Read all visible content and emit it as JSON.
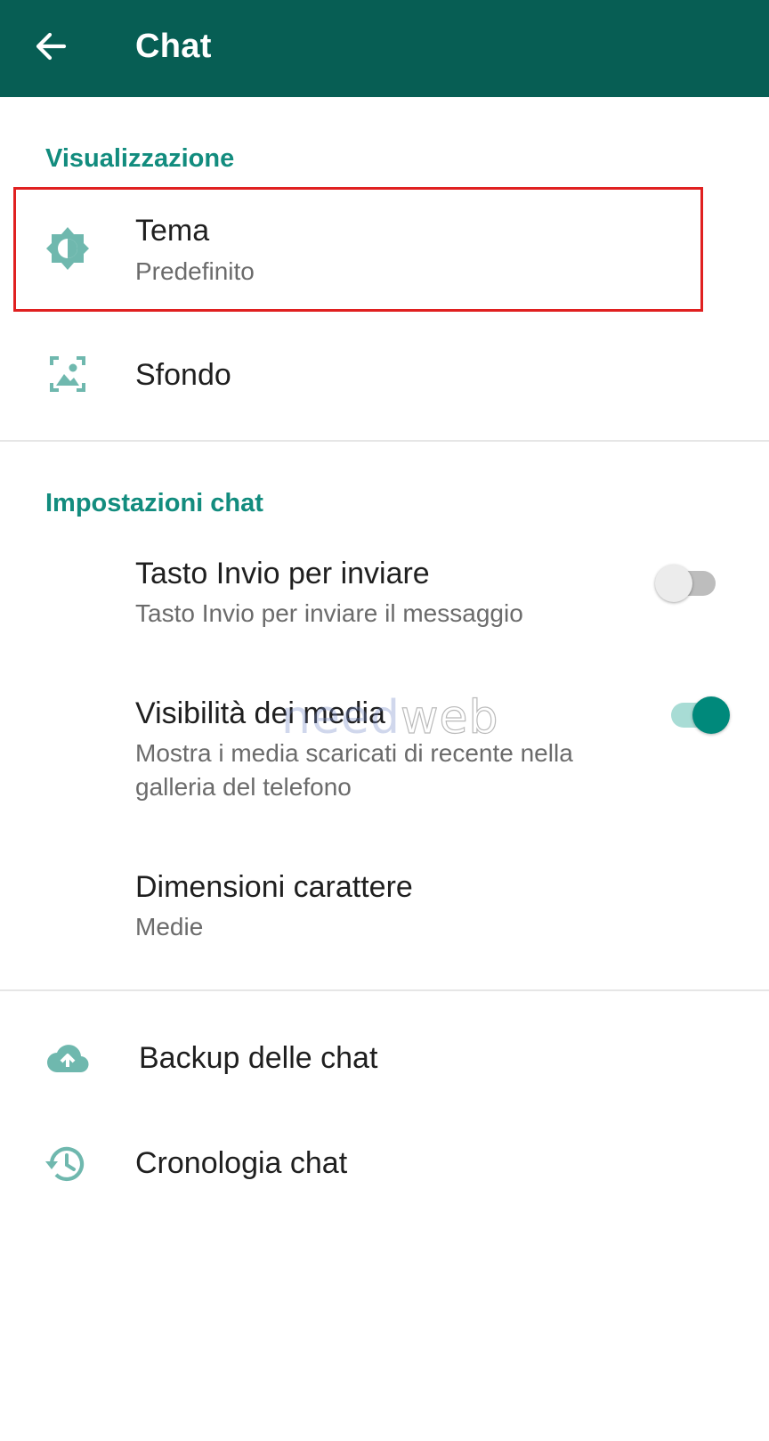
{
  "appbar": {
    "title": "Chat",
    "back_icon": "arrow-left-icon",
    "background_color": "#075e54"
  },
  "sections": {
    "display_header": "Visualizzazione",
    "chat_settings_header": "Impostazioni chat"
  },
  "rows": {
    "theme": {
      "title": "Tema",
      "subtitle": "Predefinito",
      "icon": "brightness-icon"
    },
    "wallpaper": {
      "title": "Sfondo",
      "icon": "wallpaper-icon"
    },
    "enter_send": {
      "title": "Tasto Invio per inviare",
      "subtitle": "Tasto Invio per inviare il messaggio",
      "toggle": false
    },
    "media_visibility": {
      "title": "Visibilità dei media",
      "subtitle_line1": "Mostra i media scaricati di recente nella",
      "subtitle_line2": "galleria del telefono",
      "toggle": true
    },
    "font_size": {
      "title": "Dimensioni carattere",
      "subtitle": "Medie"
    },
    "backup": {
      "title": "Backup delle chat",
      "icon": "cloud-upload-icon"
    },
    "history": {
      "title": "Cronologia chat",
      "icon": "history-icon"
    }
  },
  "watermark": {
    "part1": "need",
    "part2": "web"
  },
  "colors": {
    "accent": "#128c7e",
    "icon_tint": "#6fb8ae",
    "toggle_on_thumb": "#00897b",
    "toggle_on_track": "#a8dcd5",
    "highlight_border": "#e02020"
  }
}
